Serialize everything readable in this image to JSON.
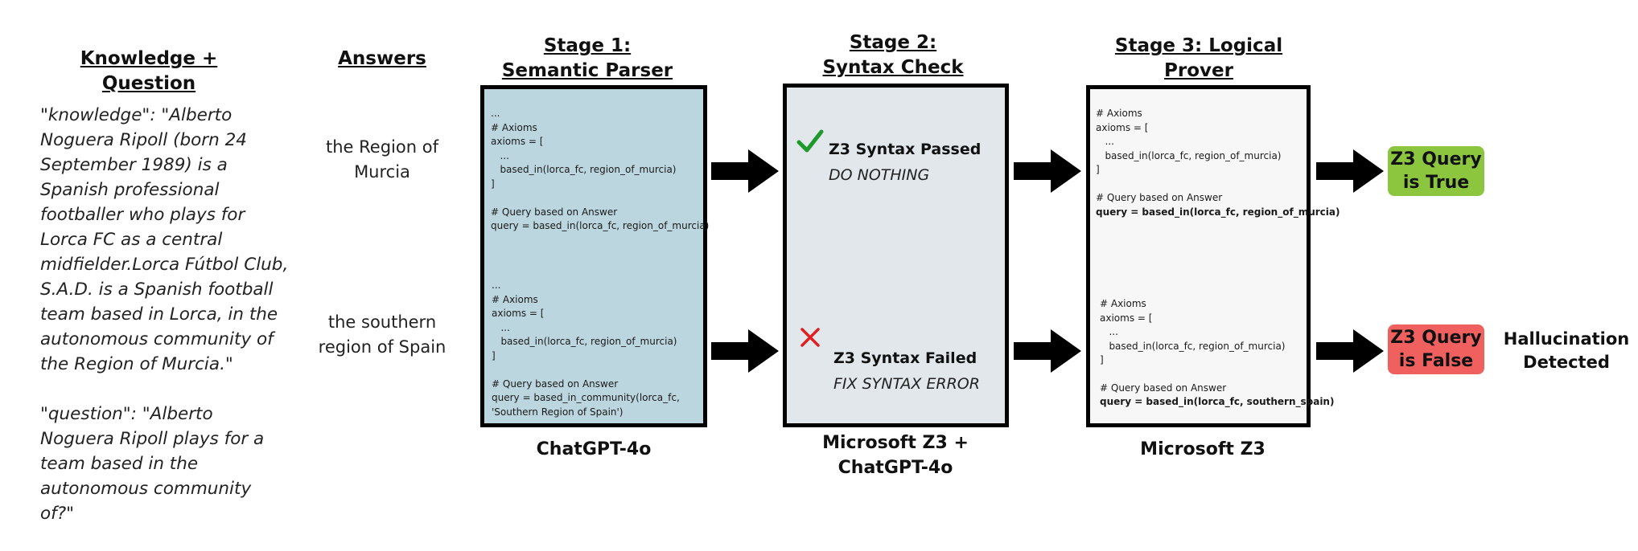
{
  "headers": {
    "knowledge_question": "Knowledge + Question",
    "answers": "Answers",
    "stage1": "Stage 1: Semantic Parser",
    "stage2": "Stage 2: Syntax Check",
    "stage3": "Stage 3: Logical Prover"
  },
  "knowledge_text": "\"knowledge\": \"Alberto Noguera Ripoll (born 24 September 1989) is a Spanish professional footballer who plays for Lorca FC as a central midfielder.Lorca Fútbol Club, S.A.D. is a Spanish football team based in Lorca, in the autonomous community of the Region of Murcia.\"",
  "question_text": "\"question\": \"Alberto Noguera Ripoll plays for a team based in the autonomous community of?\"",
  "answers": {
    "top": "the Region of Murcia",
    "bottom": "the southern region of Spain"
  },
  "stage1": {
    "top_code": "...\n# Axioms\naxioms = [\n   ...\n   based_in(lorca_fc, region_of_murcia)\n]\n\n# Query based on Answer\nquery = based_in(lorca_fc, region_of_murcia)",
    "bottom_code": "...\n# Axioms\naxioms = [\n   ...\n   based_in(lorca_fc, region_of_murcia)\n]\n\n# Query based on Answer\nquery = based_in_community(lorca_fc,\n'Southern Region of Spain')",
    "footer": "ChatGPT-4o"
  },
  "stage2": {
    "top_status": "Z3 Syntax Passed",
    "top_action": "DO NOTHING",
    "bottom_status": "Z3 Syntax Failed",
    "bottom_action": "FIX SYNTAX ERROR",
    "footer_line1": "Microsoft Z3 +",
    "footer_line2": "ChatGPT-4o"
  },
  "stage3": {
    "top_code": "# Axioms\naxioms = [\n   ...\n   based_in(lorca_fc, region_of_murcia)\n]\n\n# Query based on Answer",
    "top_query": "query = based_in(lorca_fc, region_of_murcia)",
    "bottom_code": "# Axioms\naxioms = [\n   ...\n   based_in(lorca_fc, region_of_murcia)\n]\n\n# Query based on Answer",
    "bottom_query": "query = based_in(lorca_fc, southern_spain)",
    "footer": "Microsoft Z3"
  },
  "results": {
    "true_label": "Z3 Query is True",
    "false_label": "Z3 Query is False",
    "hallucination": "Hallucination Detected"
  },
  "colors": {
    "stage1_fill": "#bcd6df",
    "stage2_fill": "#e1e7eb",
    "stage3_fill": "#f7f7f7",
    "true_badge": "#8cc63e",
    "false_badge": "#f0605f",
    "check": "#1e9a2c",
    "cross": "#e02020"
  },
  "icons": [
    "check-icon",
    "cross-icon",
    "arrow-right-icon"
  ]
}
